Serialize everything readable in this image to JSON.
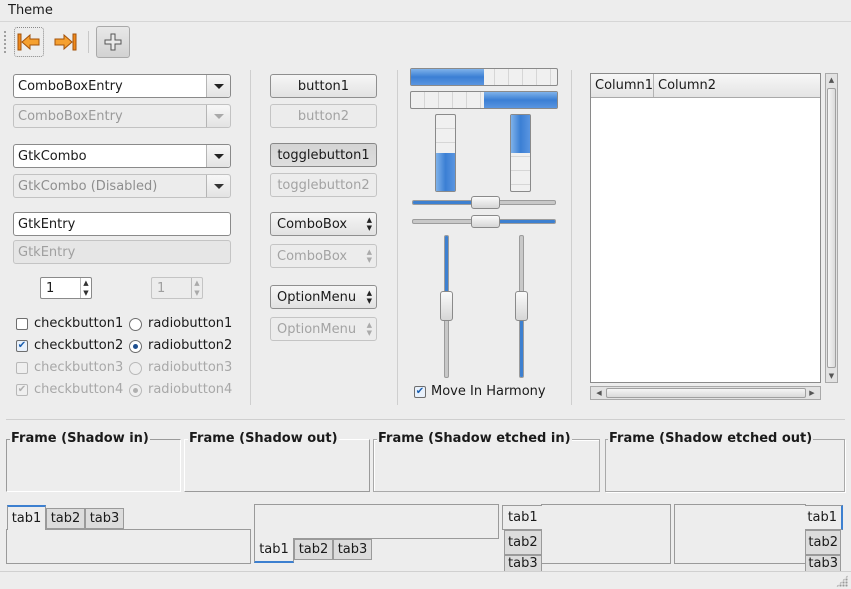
{
  "menubar": {
    "theme": "Theme"
  },
  "toolbar": {
    "back_icon": "arrow-left-icon",
    "forward_icon": "arrow-right-icon",
    "add_icon": "plus-icon"
  },
  "col1": {
    "combobox_entry": "ComboBoxEntry",
    "combobox_entry_disabled": "ComboBoxEntry",
    "gtk_combo": "GtkCombo",
    "gtk_combo_disabled": "GtkCombo (Disabled)",
    "gtk_entry": "GtkEntry",
    "gtk_entry_placeholder": "GtkEntry",
    "spin_value": "1",
    "spin_value_disabled": "1",
    "checks": [
      "checkbutton1",
      "checkbutton2",
      "checkbutton3",
      "checkbutton4"
    ],
    "radios": [
      "radiobutton1",
      "radiobutton2",
      "radiobutton3",
      "radiobutton4"
    ],
    "checked": [
      false,
      true,
      false,
      true
    ],
    "radio_selected": [
      false,
      true,
      false,
      true
    ]
  },
  "col2": {
    "button1": "button1",
    "button2": "button2",
    "toggle1": "togglebutton1",
    "toggle2": "togglebutton2",
    "combobox": "ComboBox",
    "combobox_disabled": "ComboBox",
    "optionmenu": "OptionMenu",
    "optionmenu_disabled": "OptionMenu"
  },
  "col3": {
    "hprogress1": 0.5,
    "hprogress2": 0.5,
    "vprogress1": 0.5,
    "vprogress2": 0.5,
    "hscale1": 0.5,
    "hscale2": 0.5,
    "vscale1": 0.5,
    "vscale2": 0.5,
    "move_in_harmony": "Move In Harmony",
    "move_in_harmony_checked": true
  },
  "tree": {
    "columns": [
      "Column1",
      "Column2"
    ]
  },
  "frames": [
    "Frame (Shadow in)",
    "Frame (Shadow out)",
    "Frame (Shadow etched in)",
    "Frame (Shadow etched out)"
  ],
  "notebooks": {
    "tabs": [
      "tab1",
      "tab2",
      "tab3"
    ]
  },
  "colors": {
    "accent": "#3d80d0",
    "arrow_orange": "#f08a1c"
  }
}
